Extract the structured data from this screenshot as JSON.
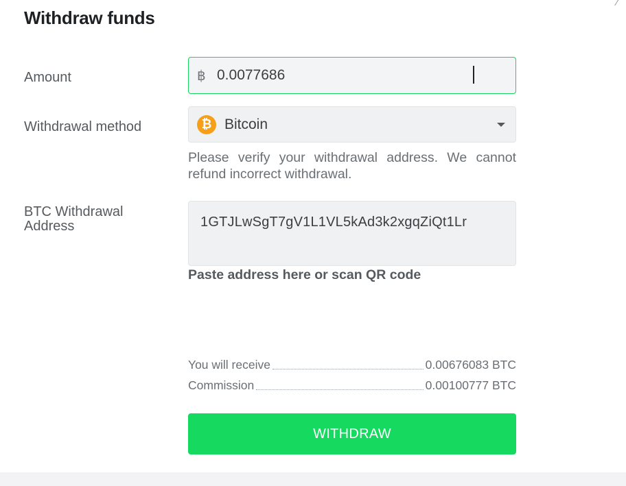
{
  "dialog": {
    "title": "Withdraw funds"
  },
  "form": {
    "amount": {
      "label": "Amount",
      "currency_symbol": "฿",
      "value": "0.0077686"
    },
    "method": {
      "label": "Withdrawal method",
      "selected": "Bitcoin",
      "icon": "bitcoin-icon",
      "icon_glyph": "₿",
      "icon_color": "#f6a01a"
    },
    "notice": "Please verify your withdrawal address. We cannot refund incorrect withdrawal.",
    "address": {
      "label": "BTC Withdrawal Address",
      "value": "1GTJLwSgT7gV1L1VL5kAd3k2xgqZiQt1Lr",
      "hint": "Paste address here or scan QR code"
    }
  },
  "summary": {
    "receive_label": "You will receive",
    "receive_value": "0.00676083 BTC",
    "commission_label": "Commission",
    "commission_value": "0.00100777 BTC"
  },
  "actions": {
    "withdraw_label": "WITHDRAW"
  },
  "colors": {
    "accent_green": "#16da5f",
    "focus_border": "#18d45f",
    "bitcoin_orange": "#f6a01a"
  }
}
